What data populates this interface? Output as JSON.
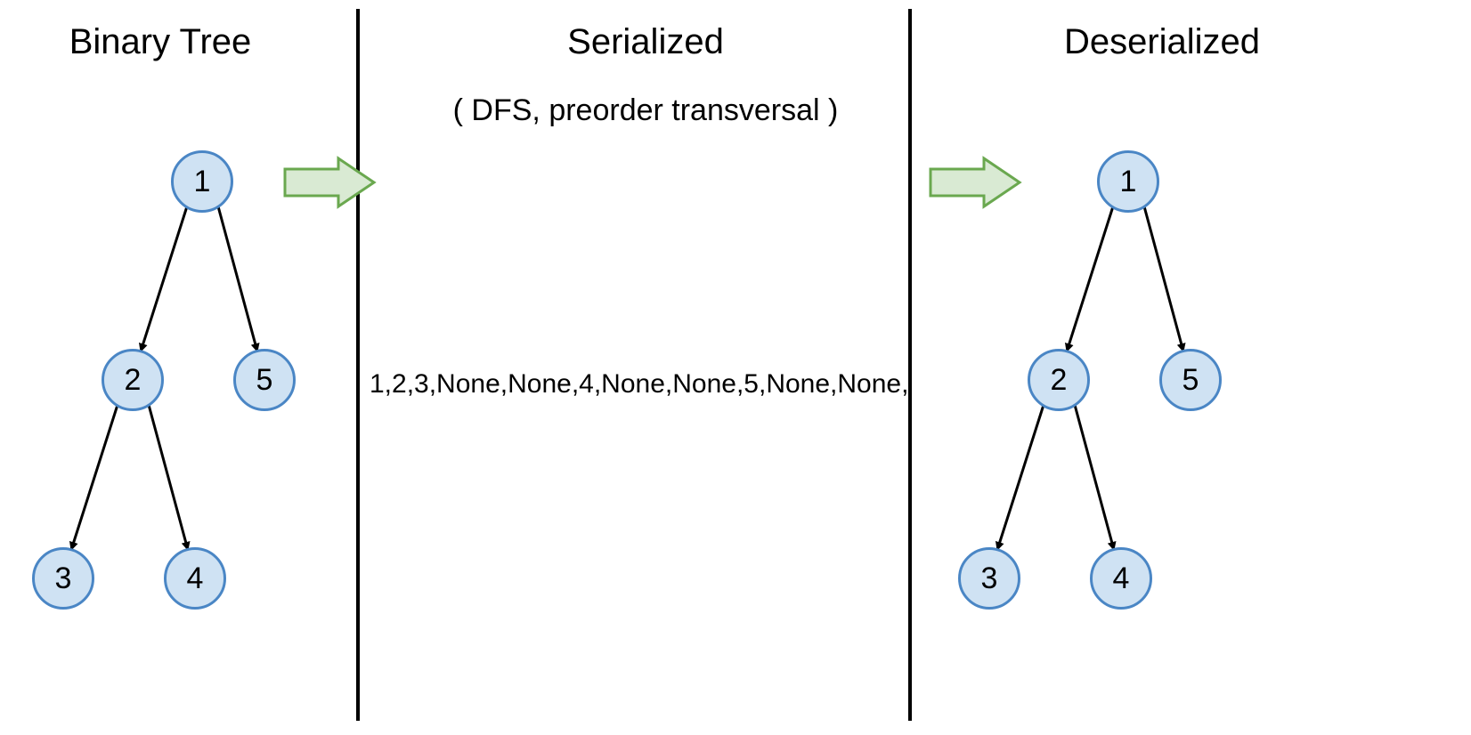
{
  "titles": {
    "binary_tree": "Binary Tree",
    "serialized": "Serialized",
    "serialized_sub": "( DFS, preorder transversal )",
    "deserialized": "Deserialized"
  },
  "serialized_string": "1,2,3,None,None,4,None,None,5,None,None,",
  "nodes": {
    "n1": "1",
    "n2": "2",
    "n3": "3",
    "n4": "4",
    "n5": "5"
  },
  "colors": {
    "node_fill": "#cfe2f3",
    "node_stroke": "#4a86c5",
    "arrow_fill": "#d9ead3",
    "arrow_stroke": "#6aa84f"
  },
  "tree_structure": {
    "value": 1,
    "left": {
      "value": 2,
      "left": {
        "value": 3,
        "left": null,
        "right": null
      },
      "right": {
        "value": 4,
        "left": null,
        "right": null
      }
    },
    "right": {
      "value": 5,
      "left": null,
      "right": null
    }
  }
}
